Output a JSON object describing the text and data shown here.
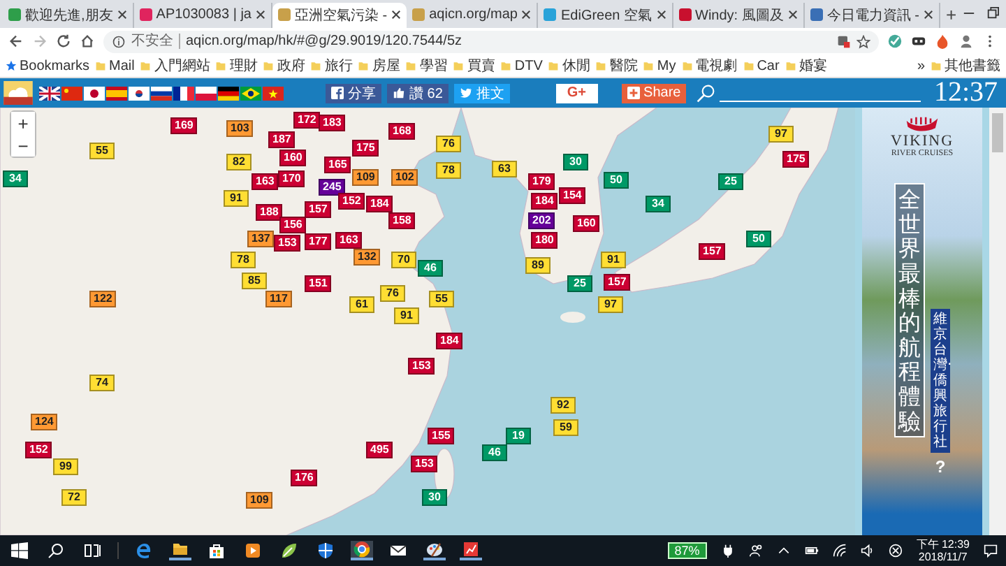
{
  "browser": {
    "tabs": [
      {
        "title": "歡迎先進,朋友",
        "selected": false
      },
      {
        "title": "AP1030083 | ja",
        "selected": false
      },
      {
        "title": "亞洲空氣污染 -",
        "selected": true
      },
      {
        "title": "aqicn.org/map",
        "selected": false
      },
      {
        "title": "EdiGreen 空氣",
        "selected": false
      },
      {
        "title": "Windy: 風圖及",
        "selected": false
      },
      {
        "title": "今日電力資訊 -",
        "selected": false
      }
    ],
    "new_tab": "+",
    "security": "不安全",
    "url": "aqicn.org/map/hk/#@g/29.9019/120.7544/5z",
    "bookmarks": [
      "Bookmarks",
      "Mail",
      "入門網站",
      "理財",
      "政府",
      "旅行",
      "房屋",
      "學習",
      "買賣",
      "DTV",
      "休閒",
      "醫院",
      "My",
      "電視劇",
      "Car",
      "婚宴"
    ],
    "more_bookmarks": "»",
    "other_bookmarks": "其他書籤"
  },
  "site_bar": {
    "share_facebook": "分享",
    "like": "讚 62",
    "tweet": "推文",
    "google_plus": "G+",
    "share": "Share",
    "time": "12:37"
  },
  "map": {
    "zoom_in": "+",
    "zoom_out": "−",
    "markers": [
      {
        "value": "34",
        "color": "#009966"
      },
      {
        "value": "55",
        "color": "#ffde33"
      },
      {
        "value": "169",
        "color": "#cc0033"
      },
      {
        "value": "103",
        "color": "#ff9933"
      },
      {
        "value": "172",
        "color": "#cc0033"
      },
      {
        "value": "183",
        "color": "#cc0033"
      },
      {
        "value": "168",
        "color": "#cc0033"
      },
      {
        "value": "76",
        "color": "#ffde33"
      },
      {
        "value": "187",
        "color": "#cc0033"
      },
      {
        "value": "82",
        "color": "#ffde33"
      },
      {
        "value": "160",
        "color": "#cc0033"
      },
      {
        "value": "165",
        "color": "#cc0033"
      },
      {
        "value": "175",
        "color": "#cc0033"
      },
      {
        "value": "78",
        "color": "#ffde33"
      },
      {
        "value": "63",
        "color": "#ffde33"
      },
      {
        "value": "163",
        "color": "#cc0033"
      },
      {
        "value": "170",
        "color": "#cc0033"
      },
      {
        "value": "245",
        "color": "#660099"
      },
      {
        "value": "109",
        "color": "#ff9933"
      },
      {
        "value": "102",
        "color": "#ff9933"
      },
      {
        "value": "91",
        "color": "#ffde33"
      },
      {
        "value": "152",
        "color": "#cc0033"
      },
      {
        "value": "184",
        "color": "#cc0033"
      },
      {
        "value": "188",
        "color": "#cc0033"
      },
      {
        "value": "157",
        "color": "#cc0033"
      },
      {
        "value": "158",
        "color": "#cc0033"
      },
      {
        "value": "156",
        "color": "#cc0033"
      },
      {
        "value": "137",
        "color": "#ff9933"
      },
      {
        "value": "153",
        "color": "#cc0033"
      },
      {
        "value": "177",
        "color": "#cc0033"
      },
      {
        "value": "163",
        "color": "#cc0033"
      },
      {
        "value": "78",
        "color": "#ffde33"
      },
      {
        "value": "132",
        "color": "#ff9933"
      },
      {
        "value": "70",
        "color": "#ffde33"
      },
      {
        "value": "46",
        "color": "#009966"
      },
      {
        "value": "85",
        "color": "#ffde33"
      },
      {
        "value": "151",
        "color": "#cc0033"
      },
      {
        "value": "117",
        "color": "#ff9933"
      },
      {
        "value": "76",
        "color": "#ffde33"
      },
      {
        "value": "61",
        "color": "#ffde33"
      },
      {
        "value": "91",
        "color": "#ffde33"
      },
      {
        "value": "55",
        "color": "#ffde33"
      },
      {
        "value": "30",
        "color": "#009966"
      },
      {
        "value": "179",
        "color": "#cc0033"
      },
      {
        "value": "50",
        "color": "#009966"
      },
      {
        "value": "154",
        "color": "#cc0033"
      },
      {
        "value": "184",
        "color": "#cc0033"
      },
      {
        "value": "202",
        "color": "#660099"
      },
      {
        "value": "160",
        "color": "#cc0033"
      },
      {
        "value": "180",
        "color": "#cc0033"
      },
      {
        "value": "89",
        "color": "#ffde33"
      },
      {
        "value": "91",
        "color": "#ffde33"
      },
      {
        "value": "25",
        "color": "#009966"
      },
      {
        "value": "157",
        "color": "#cc0033"
      },
      {
        "value": "97",
        "color": "#ffde33"
      },
      {
        "value": "34",
        "color": "#009966"
      },
      {
        "value": "25",
        "color": "#009966"
      },
      {
        "value": "97",
        "color": "#ffde33"
      },
      {
        "value": "175",
        "color": "#cc0033"
      },
      {
        "value": "157",
        "color": "#cc0033"
      },
      {
        "value": "50",
        "color": "#009966"
      },
      {
        "value": "122",
        "color": "#ff9933"
      },
      {
        "value": "74",
        "color": "#ffde33"
      },
      {
        "value": "124",
        "color": "#ff9933"
      },
      {
        "value": "152",
        "color": "#cc0033"
      },
      {
        "value": "99",
        "color": "#ffde33"
      },
      {
        "value": "72",
        "color": "#ffde33"
      },
      {
        "value": "184",
        "color": "#cc0033"
      },
      {
        "value": "153",
        "color": "#cc0033"
      },
      {
        "value": "155",
        "color": "#cc0033"
      },
      {
        "value": "495",
        "color": "#cc0033"
      },
      {
        "value": "153",
        "color": "#cc0033"
      },
      {
        "value": "176",
        "color": "#cc0033"
      },
      {
        "value": "109",
        "color": "#ff9933"
      },
      {
        "value": "30",
        "color": "#009966"
      },
      {
        "value": "46",
        "color": "#009966"
      },
      {
        "value": "19",
        "color": "#009966"
      },
      {
        "value": "92",
        "color": "#ffde33"
      },
      {
        "value": "59",
        "color": "#ffde33"
      }
    ]
  },
  "ad": {
    "brand": "VIKING",
    "brand_sub": "RIVER CRUISES",
    "slogan": "全世界最棒的航程體驗",
    "agent": "維京台灣‧僑興旅行社",
    "help": "?"
  },
  "taskbar": {
    "battery": "87%",
    "time": "下午 12:39",
    "date": "2018/11/7"
  }
}
